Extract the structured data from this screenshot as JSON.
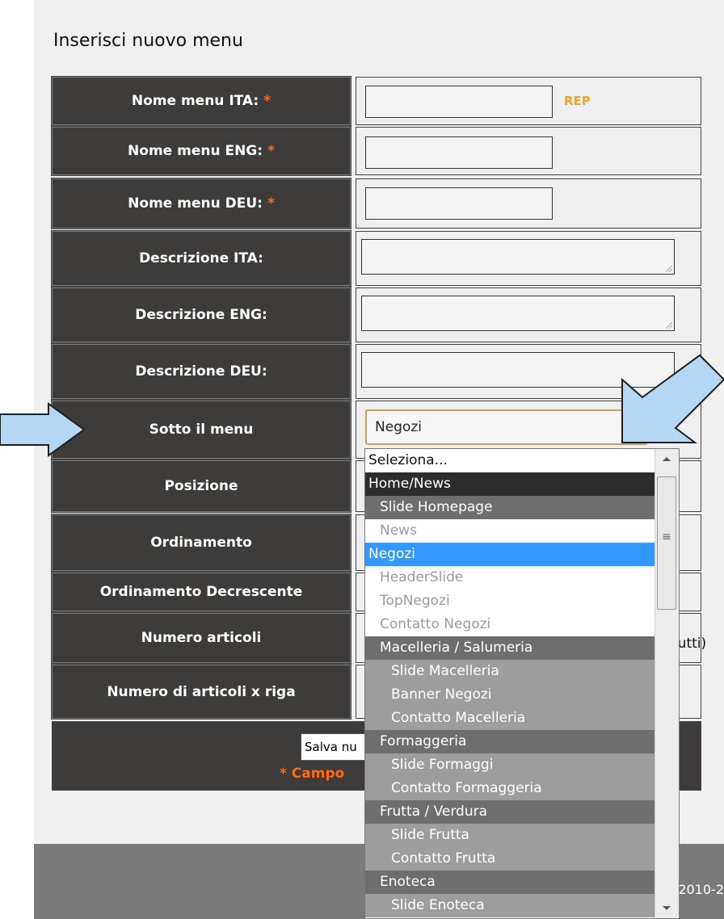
{
  "form_title": "Inserisci nuovo menu",
  "fields": [
    {
      "label": "Nome menu ITA:",
      "required": true
    },
    {
      "label": "Nome menu ENG:",
      "required": true
    },
    {
      "label": "Nome menu DEU:",
      "required": true
    },
    {
      "label": "Descrizione ITA:"
    },
    {
      "label": "Descrizione ENG:"
    },
    {
      "label": "Descrizione DEU:"
    },
    {
      "label": "Sotto il menu"
    },
    {
      "label": "Posizione"
    },
    {
      "label": "Ordinamento"
    },
    {
      "label": "Ordinamento Decrescente"
    },
    {
      "label": "Numero articoli"
    },
    {
      "label": "Numero di articoli x riga"
    }
  ],
  "required_star": "*",
  "rep_label": "REP",
  "parent_menu_select": {
    "selected": "Negozi",
    "options": [
      {
        "label": "Seleziona...",
        "style": "plain"
      },
      {
        "label": "Home/News",
        "style": "dark"
      },
      {
        "label": "Slide Homepage",
        "style": "mid",
        "indent": 1
      },
      {
        "label": "News",
        "style": "disabled",
        "indent": 1
      },
      {
        "label": "Negozi",
        "style": "selected"
      },
      {
        "label": "HeaderSlide",
        "style": "disabled",
        "indent": 1
      },
      {
        "label": "TopNegozi",
        "style": "disabled",
        "indent": 1
      },
      {
        "label": "Contatto Negozi",
        "style": "disabled",
        "indent": 1
      },
      {
        "label": "Macelleria / Salumeria",
        "style": "mid",
        "indent": 1
      },
      {
        "label": "Slide Macelleria",
        "style": "light",
        "indent": 2
      },
      {
        "label": "Banner Negozi",
        "style": "light",
        "indent": 2
      },
      {
        "label": "Contatto Macelleria",
        "style": "light",
        "indent": 2
      },
      {
        "label": "Formaggeria",
        "style": "mid",
        "indent": 1
      },
      {
        "label": "Slide Formaggi",
        "style": "light",
        "indent": 2
      },
      {
        "label": "Contatto Formaggeria",
        "style": "light",
        "indent": 2
      },
      {
        "label": "Frutta / Verdura",
        "style": "mid",
        "indent": 1
      },
      {
        "label": "Slide Frutta",
        "style": "light",
        "indent": 2
      },
      {
        "label": "Contatto Frutta",
        "style": "light",
        "indent": 2
      },
      {
        "label": "Enoteca",
        "style": "mid",
        "indent": 1
      },
      {
        "label": "Slide Enoteca",
        "style": "light",
        "indent": 2
      }
    ]
  },
  "num_articoli_suffix": "tutti)",
  "save_button_label": "Salva nu",
  "required_note": "* Campo",
  "copyright": "© 2010-2",
  "colors": {
    "label_bg": "#3e3c3a",
    "required": "#ff6a1a",
    "rep": "#f2a516",
    "option_dark": "#2d2d2d",
    "option_mid": "#6e6e6e",
    "option_light": "#9d9d9d",
    "option_selected": "#3399ff"
  }
}
